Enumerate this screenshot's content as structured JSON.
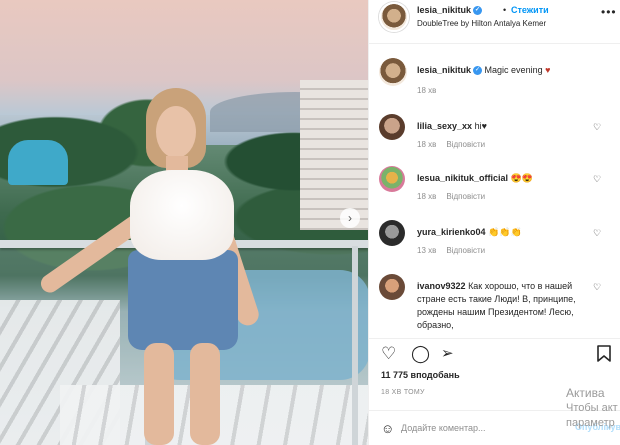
{
  "post": {
    "username": "lesia_nikituk",
    "follow_label": "Стежити",
    "separator": "•",
    "location": "DoubleTree by Hilton Antalya Kemer",
    "more_icon": "more-horizontal-icon"
  },
  "caption": {
    "username": "lesia_nikituk",
    "text": "Magic evening",
    "emoji": "♥",
    "time": "18 хв"
  },
  "comments": [
    {
      "username": "lilia_sexy_xx",
      "text": "hi♥",
      "time": "18 хв",
      "reply": "Відповісти"
    },
    {
      "username": "lesua_nikituk_official",
      "text": "😍😍",
      "time": "18 хв",
      "reply": "Відповісти"
    },
    {
      "username": "yura_kirienko04",
      "text": "👏👏👏",
      "time": "13 хв",
      "reply": "Відповісти"
    },
    {
      "username": "ivanov9322",
      "text": "Как хорошо, что в нашей стране есть такие Люди! В, принципе, рождены нашим Президентом! Лесю, образно,",
      "time": "",
      "reply": ""
    }
  ],
  "actions": {
    "like_icon": "heart-icon",
    "comment_icon": "comment-icon",
    "share_icon": "share-icon",
    "save_icon": "bookmark-icon"
  },
  "likes_text": "11 775 вподобань",
  "time_ago": "18 ХВ ТОМУ",
  "add_comment": {
    "placeholder": "Додайте коментар...",
    "post_label": "Опублікувати"
  },
  "watermark": {
    "line1": "Актива",
    "line2": "Чтобы акт",
    "line3": "параметр"
  },
  "colors": {
    "link": "#0095f6",
    "verified": "#3897f0",
    "muted": "#8e8e8e",
    "post_disabled": "#b2dffc"
  }
}
